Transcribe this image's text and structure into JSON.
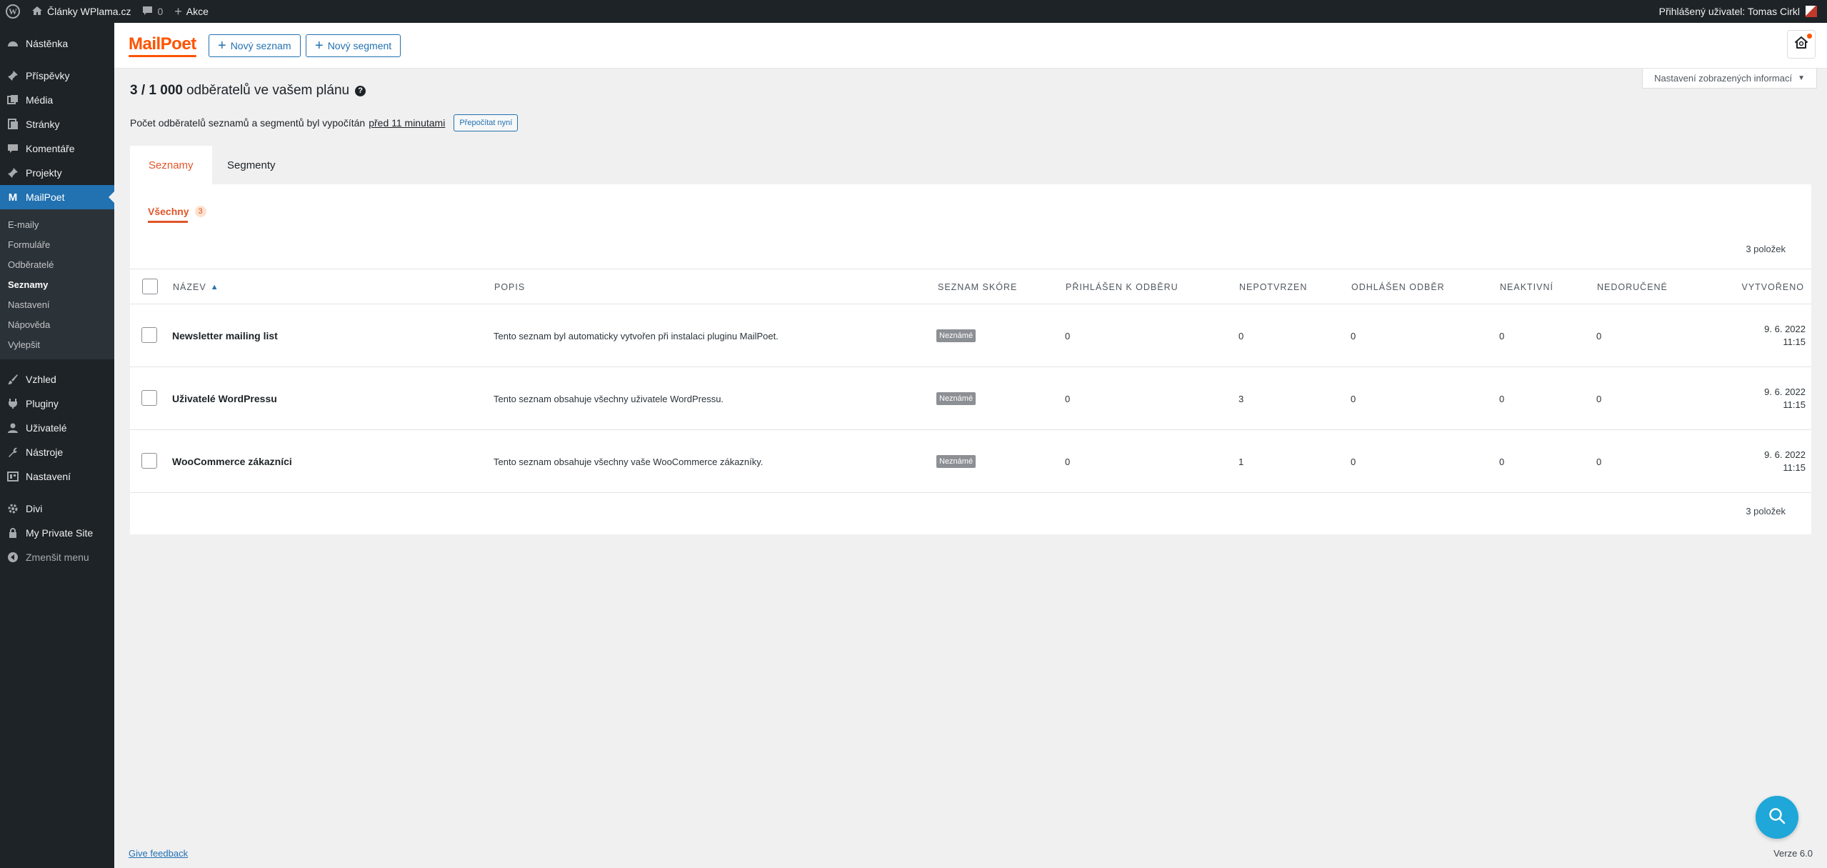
{
  "adminbar": {
    "site_name": "Články WPlama.cz",
    "comments_count": "0",
    "new_label": "Akce",
    "howdy": "Přihlášený uživatel: Tomas Cirkl"
  },
  "sidebar": {
    "items_top": [
      {
        "label": "Nástěnka",
        "icon": "dashboard-icon"
      }
    ],
    "items_main": [
      {
        "label": "Příspěvky",
        "icon": "pin-icon"
      },
      {
        "label": "Média",
        "icon": "media-icon"
      },
      {
        "label": "Stránky",
        "icon": "page-icon"
      },
      {
        "label": "Komentáře",
        "icon": "comment-icon"
      },
      {
        "label": "Projekty",
        "icon": "pin-icon"
      },
      {
        "label": "MailPoet",
        "icon": "mailpoet-icon"
      }
    ],
    "submenu": [
      "E-maily",
      "Formuláře",
      "Odběratelé",
      "Seznamy",
      "Nastavení",
      "Nápověda",
      "Vylepšit"
    ],
    "submenu_current": "Seznamy",
    "items_bottom": [
      {
        "label": "Vzhled",
        "icon": "brush-icon"
      },
      {
        "label": "Pluginy",
        "icon": "plugin-icon"
      },
      {
        "label": "Uživatelé",
        "icon": "user-icon"
      },
      {
        "label": "Nástroje",
        "icon": "wrench-icon"
      },
      {
        "label": "Nastavení",
        "icon": "settings-icon"
      }
    ],
    "items_extra": [
      {
        "label": "Divi",
        "icon": "gear-icon"
      },
      {
        "label": "My Private Site",
        "icon": "lock-icon"
      },
      {
        "label": "Zmenšit menu",
        "icon": "collapse-icon"
      }
    ]
  },
  "header": {
    "logo": "MailPoet",
    "new_list_label": "Nový seznam",
    "new_segment_label": "Nový segment"
  },
  "screen_options_label": "Nastavení zobrazených informací",
  "plan": {
    "count": "3 / 1 000",
    "text": "odběratelů ve vašem plánu",
    "help": "?"
  },
  "recalc": {
    "text": "Počet odběratelů seznamů a segmentů byl vypočítán",
    "ago": "před 11 minutami",
    "button": "Přepočítat nyní"
  },
  "tabs": [
    "Seznamy",
    "Segmenty"
  ],
  "filter": {
    "label": "Všechny",
    "count": "3"
  },
  "items_count": "3 položek",
  "columns": [
    "Název",
    "Popis",
    "Seznam skóre",
    "Přihlášen k odběru",
    "Nepotvrzen",
    "Odhlášen odběr",
    "Neaktivní",
    "Nedoručené",
    "Vytvořeno"
  ],
  "rows": [
    {
      "name": "Newsletter mailing list",
      "desc": "Tento seznam byl automaticky vytvořen při instalaci pluginu MailPoet.",
      "score": "Neznámé",
      "subscribed": "0",
      "unconfirmed": "0",
      "unsubscribed": "0",
      "inactive": "0",
      "bounced": "0",
      "created": "9. 6. 2022\n11:15"
    },
    {
      "name": "Uživatelé WordPressu",
      "desc": "Tento seznam obsahuje všechny uživatele WordPressu.",
      "score": "Neznámé",
      "subscribed": "0",
      "unconfirmed": "3",
      "unsubscribed": "0",
      "inactive": "0",
      "bounced": "0",
      "created": "9. 6. 2022\n11:15"
    },
    {
      "name": "WooCommerce zákazníci",
      "desc": "Tento seznam obsahuje všechny vaše WooCommerce zákazníky.",
      "score": "Neznámé",
      "subscribed": "0",
      "unconfirmed": "1",
      "unsubscribed": "0",
      "inactive": "0",
      "bounced": "0",
      "created": "9. 6. 2022\n11:15"
    }
  ],
  "footer": {
    "feedback": "Give feedback",
    "version": "Verze 6.0"
  },
  "colors": {
    "accent": "#e0562a",
    "link": "#2271b1",
    "admin_bg": "#1d2327",
    "beacon": "#1ea7d8"
  }
}
